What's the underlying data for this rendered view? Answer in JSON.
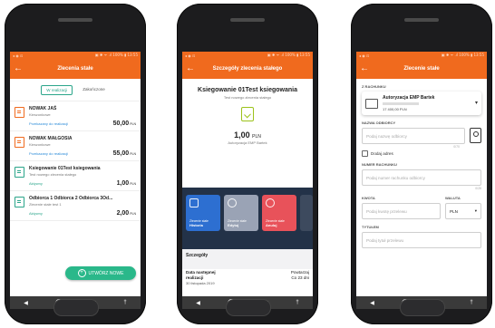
{
  "status_bar": {
    "left": "◂ ◉ ⊡",
    "right": "▣ ✱ ᯤ .ıl 100% ▮ 13:55"
  },
  "screen1": {
    "title": "Zlecenia stałe",
    "tabs": [
      "W realizacji",
      "Zakończone"
    ],
    "orders": [
      {
        "name": "NOWAK JAŚ",
        "sub": "Kieszonkowe",
        "status": "Przekazany do realizacji",
        "amount": "50,00",
        "currency": "PLN"
      },
      {
        "name": "NOWAK MAŁGOSIA",
        "sub": "Kieszonkowe",
        "status": "Przekazany do realizacji",
        "amount": "55,00",
        "currency": "PLN"
      },
      {
        "name": "Ksiegowanie 01Test ksiegowania",
        "sub": "Test nowego zlecenia stałego",
        "status": "Aktywny",
        "amount": "1,00",
        "currency": "PLN"
      },
      {
        "name": "Odbiorca 1 Odbiorca 2 Odbiorca 3Od...",
        "sub": "Zlecenie stałe test 1",
        "status": "Aktywny",
        "amount": "2,00",
        "currency": "PLN"
      }
    ],
    "fab_label": "UTWÓRZ NOWE"
  },
  "screen2": {
    "title": "Szczegóły zlecenia stałego",
    "heading": "Ksiegowanie 01Test ksiegowania",
    "subheading": "Test nowego zlecenia stałego",
    "amount": "1,00",
    "currency": "PLN",
    "account": "Autoryzacja EMP Bartek",
    "actions": [
      {
        "small": "Zlecenie stałe",
        "label": "Historia",
        "color": "#2d6fd1"
      },
      {
        "small": "Zlecenie stałe",
        "label": "Edytuj",
        "color": "#9aa3b5"
      },
      {
        "small": "Zlecenie stałe",
        "label": "Anuluj",
        "color": "#e8525a"
      }
    ],
    "section": "Szczegóły",
    "detail_label_1": "Data następnej",
    "detail_label_2": "realizacji",
    "detail_date": "30 listopada 2019",
    "detail_value_1": "Powtarzaj",
    "detail_value_2": "Co 23 dni"
  },
  "screen3": {
    "title": "Zlecenie stałe",
    "from_label": "Z RACHUNKU",
    "account_name": "Autoryzacja EMP Bartek",
    "account_balance": "17 400,00 PLN",
    "recipient_label": "NAZWA ODBIORCY",
    "recipient_placeholder": "Podaj nazwę odbiorcy",
    "recipient_counter": "0/70",
    "add_address": "Dodaj adres",
    "account_number_label": "NUMER RACHUNKU",
    "account_number_placeholder": "Podaj numer rachunku odbiorcy",
    "account_number_counter": "0/28",
    "amount_label": "KWOTA",
    "amount_placeholder": "Podaj kwotę przelewu",
    "currency_label": "WALUTA",
    "currency_value": "PLN",
    "title_label": "TYTUŁEM",
    "title_placeholder": "Podaj tytuł przelewu"
  },
  "nav": {
    "back": "◀",
    "recent": "■",
    "extra": "†"
  },
  "colors": {
    "accent": "#f06a1e",
    "green": "#2aa58a",
    "dark": "#233248"
  }
}
